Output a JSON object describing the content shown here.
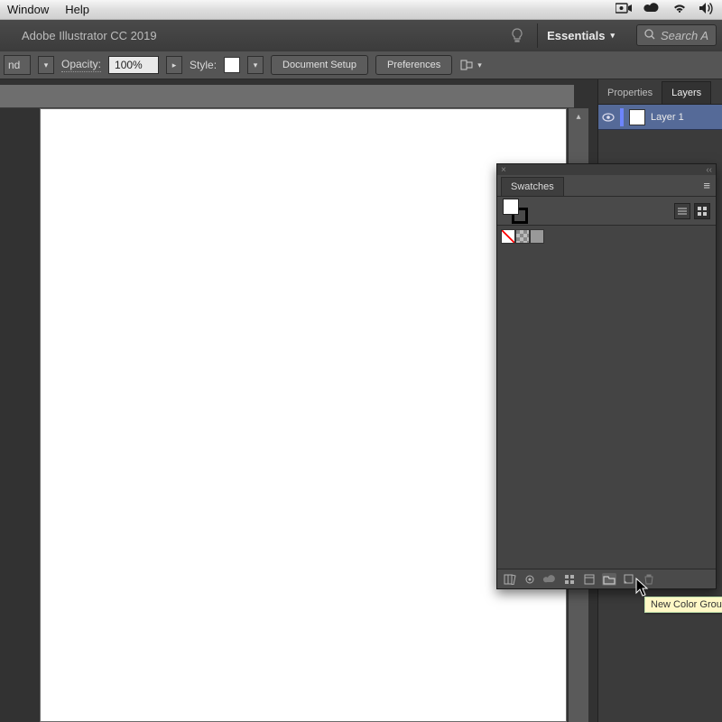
{
  "menubar": {
    "items": [
      "Window",
      "Help"
    ]
  },
  "app": {
    "title": "Adobe Illustrator CC 2019",
    "workspace": "Essentials",
    "search_placeholder": "Search A"
  },
  "control": {
    "opacity_label": "Opacity:",
    "opacity_value": "100%",
    "style_label": "Style:",
    "doc_setup": "Document Setup",
    "prefs": "Preferences",
    "nd_value": "nd"
  },
  "right_panel": {
    "tabs": [
      "Properties",
      "Layers"
    ],
    "active_tab": "Layers",
    "layer": {
      "name": "Layer 1"
    }
  },
  "swatches": {
    "title": "Swatches"
  },
  "tooltip": "New Color Group"
}
